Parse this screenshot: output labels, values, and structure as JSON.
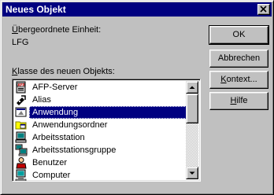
{
  "window": {
    "title": "Neues Objekt"
  },
  "parent": {
    "label_accel": "Ü",
    "label_rest": "bergeordnete Einheit:",
    "value": "LFG"
  },
  "class_label": {
    "accel": "K",
    "rest": "lasse des neuen Objekts:"
  },
  "list": {
    "items": [
      {
        "label": "AFP-Server",
        "icon": "afp-server-icon",
        "selected": false
      },
      {
        "label": "Alias",
        "icon": "alias-icon",
        "selected": false
      },
      {
        "label": "Anwendung",
        "icon": "application-icon",
        "selected": true
      },
      {
        "label": "Anwendungsordner",
        "icon": "application-folder-icon",
        "selected": false
      },
      {
        "label": "Arbeitsstation",
        "icon": "workstation-icon",
        "selected": false
      },
      {
        "label": "Arbeitsstationsgruppe",
        "icon": "workstation-group-icon",
        "selected": false
      },
      {
        "label": "Benutzer",
        "icon": "user-icon",
        "selected": false
      },
      {
        "label": "Computer",
        "icon": "computer-icon",
        "selected": false
      }
    ]
  },
  "buttons": {
    "ok": "OK",
    "cancel": "Abbrechen",
    "context": {
      "accel": "K",
      "rest": "ontext..."
    },
    "help": {
      "accel": "H",
      "rest": "ilfe"
    }
  },
  "colors": {
    "title_bg": "#000080",
    "face": "#c0c0c0",
    "selection": "#000080"
  }
}
